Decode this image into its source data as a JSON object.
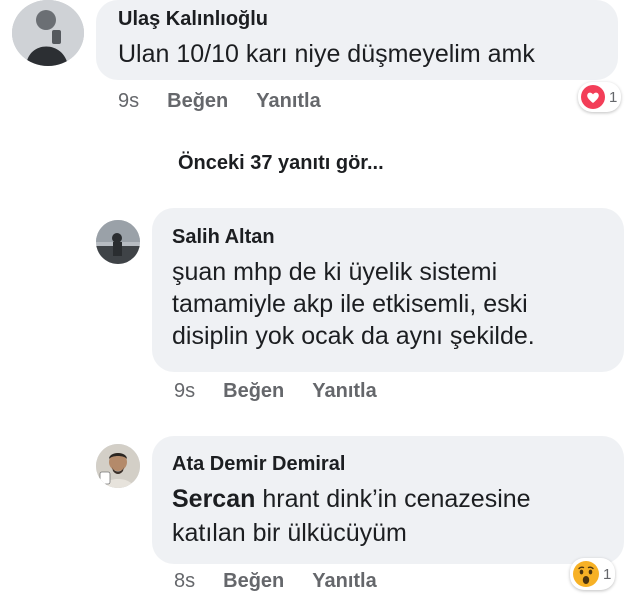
{
  "comment": {
    "author": "Ulaş Kalınlıoğlu",
    "text": "Ulan 10/10 karı niye düşmeyelim amk",
    "time": "9s",
    "like_label": "Beğen",
    "reply_label": "Yanıtla",
    "reaction": {
      "icon": "heart-reaction-icon",
      "count": "1",
      "color": "#f33e58"
    }
  },
  "more_replies_label": "Önceki 37 yanıtı gör...",
  "replies": [
    {
      "author": "Salih Altan",
      "lines": [
        "şuan mhp de ki üyelik sistemi",
        "tamamiyle akp ile etkisemli, eski",
        "disiplin yok ocak da aynı şekilde."
      ],
      "time": "9s",
      "like_label": "Beğen",
      "reply_label": "Yanıtla"
    },
    {
      "author": "Ata Demir Demiral",
      "mention": "Sercan",
      "line1_rest": " hrant dink’in cenazesine",
      "line2": "katılan bir ülkücüyüm",
      "time": "8s",
      "like_label": "Beğen",
      "reply_label": "Yanıtla",
      "reaction": {
        "icon": "wow-reaction-icon",
        "count": "1",
        "color": "#f7b125"
      }
    }
  ]
}
